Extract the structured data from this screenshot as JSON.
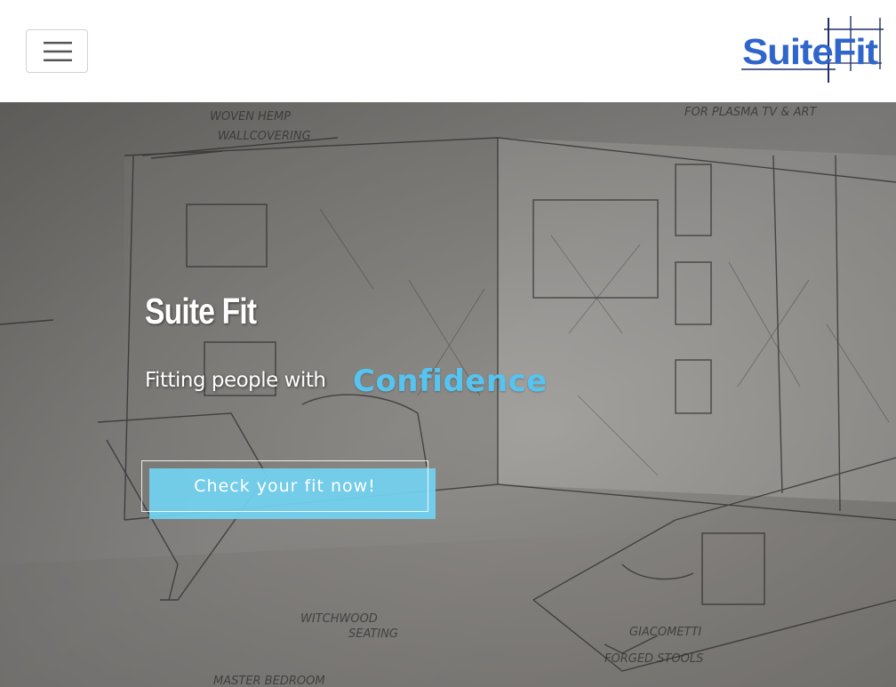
{
  "navbar": {
    "brand": "SuiteFit",
    "brand_colors": [
      "#2f66c9",
      "#1e2f6a"
    ],
    "toggler_icon": "hamburger-menu-icon"
  },
  "hero": {
    "title": "Suite Fit",
    "tagline": "Fitting people with",
    "accent": "Confidence",
    "accent_color": "#55c4f0",
    "cta_label": "Check your fit now!",
    "cta_color": "#72d2f1",
    "background": "interior-sketch-illustration"
  }
}
